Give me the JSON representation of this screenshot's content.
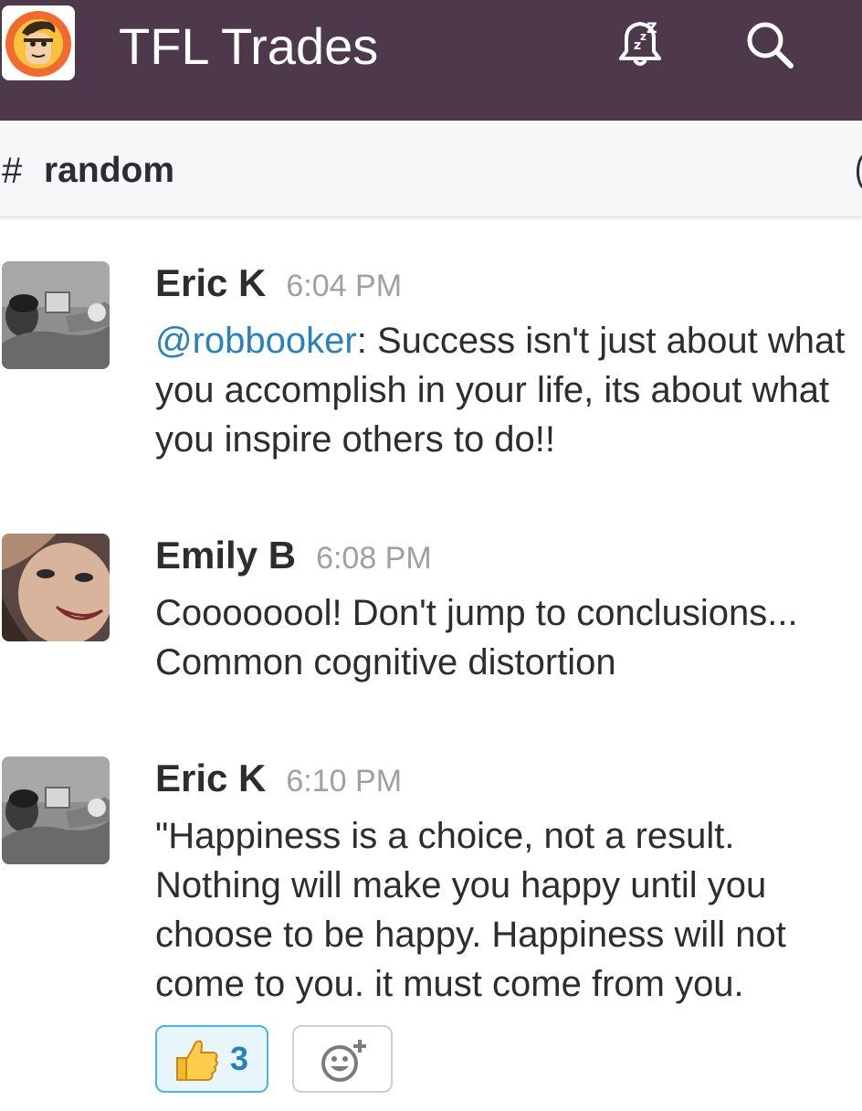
{
  "header": {
    "team_name": "TFL Trades",
    "icons": [
      "team-logo-icon",
      "snooze-bell-icon",
      "search-icon"
    ],
    "background_color": "#4d394b"
  },
  "channel": {
    "hash": "#",
    "name": "random"
  },
  "messages": [
    {
      "author": "Eric K",
      "time": "6:04 PM",
      "mention": "@robbooker",
      "text": ": Success isn't just about what you accomplish in your life, its about what you inspire others to do!!"
    },
    {
      "author": "Emily B",
      "time": "6:08 PM",
      "text": "Coooooool! Don't jump to conclusions... Common cognitive distortion"
    },
    {
      "author": "Eric K",
      "time": "6:10 PM",
      "text": "\"Happiness is a choice, not a result. Nothing will make you happy until you choose to be happy. Happiness will not come to you. it must come from you."
    }
  ],
  "reactions": [
    {
      "emoji": "thumbs-up-icon",
      "count": "3"
    }
  ],
  "add_reaction_icon": "add-reaction-icon",
  "colors": {
    "mention": "#2a80b9",
    "reaction_border": "#4eb3e0",
    "reaction_bg": "#e8f5fa"
  }
}
